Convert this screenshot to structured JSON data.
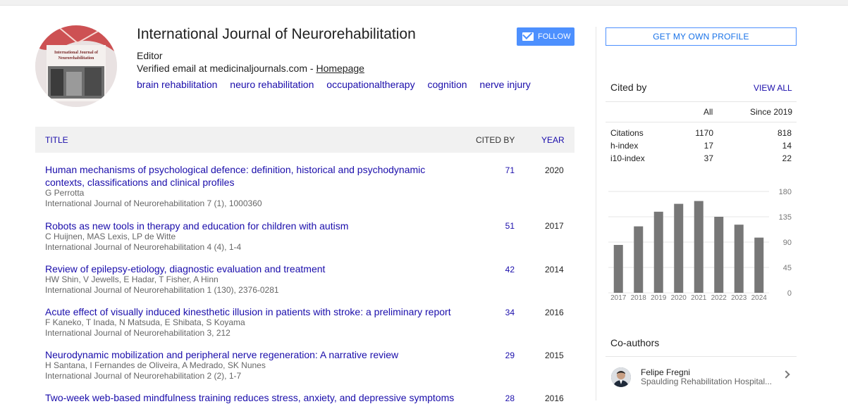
{
  "profile": {
    "name": "International Journal of Neurorehabilitation",
    "affiliation": "Editor",
    "email_prefix": "Verified email at medicinaljournals.com - ",
    "homepage": "Homepage",
    "interests": [
      "brain rehabilitation",
      "neuro rehabilitation",
      "occupationaltherapy",
      "cognition",
      "nerve injury"
    ],
    "cover_text": "International Journal of Neurorehabilitation"
  },
  "follow_label": "FOLLOW",
  "table": {
    "title_header": "TITLE",
    "cited_header": "CITED BY",
    "year_header": "YEAR",
    "rows": [
      {
        "title": "Human mechanisms of psychological defence: definition, historical and psychodynamic contexts, classifications and clinical profiles",
        "authors": "G Perrotta",
        "venue": "International Journal of Neurorehabilitation 7 (1), 1000360",
        "cites": "71",
        "year": "2020"
      },
      {
        "title": "Robots as new tools in therapy and education for children with autism",
        "authors": "C Huijnen, MAS Lexis, LP de Witte",
        "venue": "International Journal of Neurorehabilitation 4 (4), 1-4",
        "cites": "51",
        "year": "2017"
      },
      {
        "title": "Review of epilepsy-etiology, diagnostic evaluation and treatment",
        "authors": "HW Shin, V Jewells, E Hadar, T Fisher, A Hinn",
        "venue": "International Journal of Neurorehabilitation 1 (130), 2376-0281",
        "cites": "42",
        "year": "2014"
      },
      {
        "title": "Acute effect of visually induced kinesthetic illusion in patients with stroke: a preliminary report",
        "authors": "F Kaneko, T Inada, N Matsuda, E Shibata, S Koyama",
        "venue": "International Journal of Neurorehabilitation 3, 212",
        "cites": "34",
        "year": "2016"
      },
      {
        "title": "Neurodynamic mobilization and peripheral nerve regeneration: A narrative review",
        "authors": "H Santana, I Fernandes de Oliveira, A Medrado, SK Nunes",
        "venue": "International Journal of Neurorehabilitation 2 (2), 1-7",
        "cites": "29",
        "year": "2015"
      },
      {
        "title": "Two-week web-based mindfulness training reduces stress, anxiety, and depressive symptoms",
        "authors": "",
        "venue": "",
        "cites": "28",
        "year": "2016"
      }
    ]
  },
  "sidebar": {
    "get_profile": "GET MY OWN PROFILE",
    "cited_by": "Cited by",
    "view_all": "VIEW ALL",
    "col_all": "All",
    "col_since": "Since 2019",
    "stats": [
      {
        "label": "Citations",
        "all": "1170",
        "since": "818"
      },
      {
        "label": "h-index",
        "all": "17",
        "since": "14"
      },
      {
        "label": "i10-index",
        "all": "37",
        "since": "22"
      }
    ],
    "coauthors_title": "Co-authors",
    "coauthors": [
      {
        "name": "Felipe Fregni",
        "affiliation": "Spaulding Rehabilitation Hospital..."
      }
    ]
  },
  "chart_data": {
    "type": "bar",
    "categories": [
      "2017",
      "2018",
      "2019",
      "2020",
      "2021",
      "2022",
      "2023",
      "2024"
    ],
    "values": [
      85,
      118,
      144,
      158,
      163,
      135,
      121,
      98
    ],
    "ylim": [
      0,
      180
    ],
    "yticks": [
      "0",
      "45",
      "90",
      "135",
      "180"
    ],
    "bar_color": "#777777"
  },
  "colors": {
    "link": "#1a0dab",
    "follow_bg": "#4d90fe",
    "header_bg": "#f1f1f1"
  }
}
